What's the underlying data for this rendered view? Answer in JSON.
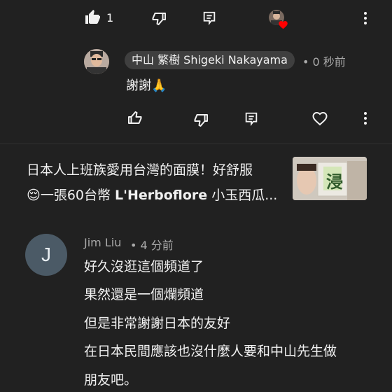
{
  "top_actions": {
    "like_count": "1",
    "like_icon": "thumb-up-filled-icon",
    "dislike_icon": "thumb-down-icon",
    "reply_icon": "reply-icon",
    "more_icon": "more-vert-icon",
    "heart_color": "#ff0000"
  },
  "reply": {
    "author": "中山 繁樹 Shigeki Nakayama",
    "time": "• 0 秒前",
    "text": "謝謝🙏"
  },
  "reply_actions": {
    "like_icon": "thumb-up-icon",
    "dislike_icon": "thumb-down-icon",
    "reply_icon": "reply-icon",
    "heart_icon": "heart-outline-icon",
    "more_icon": "more-vert-icon"
  },
  "video": {
    "title_line1": "日本人上班族愛用台灣的面膜！好舒服",
    "title_line2_emoji": "😌",
    "title_line2_plain": "一張60台幣 ",
    "title_line2_bold": "L'Herboflore",
    "title_line2_tail": " 小玉西瓜...",
    "thumbnail_text": "浸"
  },
  "comment": {
    "avatar_letter": "J",
    "author": "Jim Liu",
    "time": "• 4 分前",
    "lines": [
      "好久沒逛這個頻道了",
      "果然還是一個爛頻道",
      "但是非常謝謝日本的友好",
      "在日本民間應該也沒什麼人要和中山先生做",
      "朋友吧。"
    ]
  },
  "colors": {
    "background": "#212121",
    "chip": "#3f3f3f",
    "meta": "#aaaaaa",
    "j_avatar": "#4b5a66"
  }
}
